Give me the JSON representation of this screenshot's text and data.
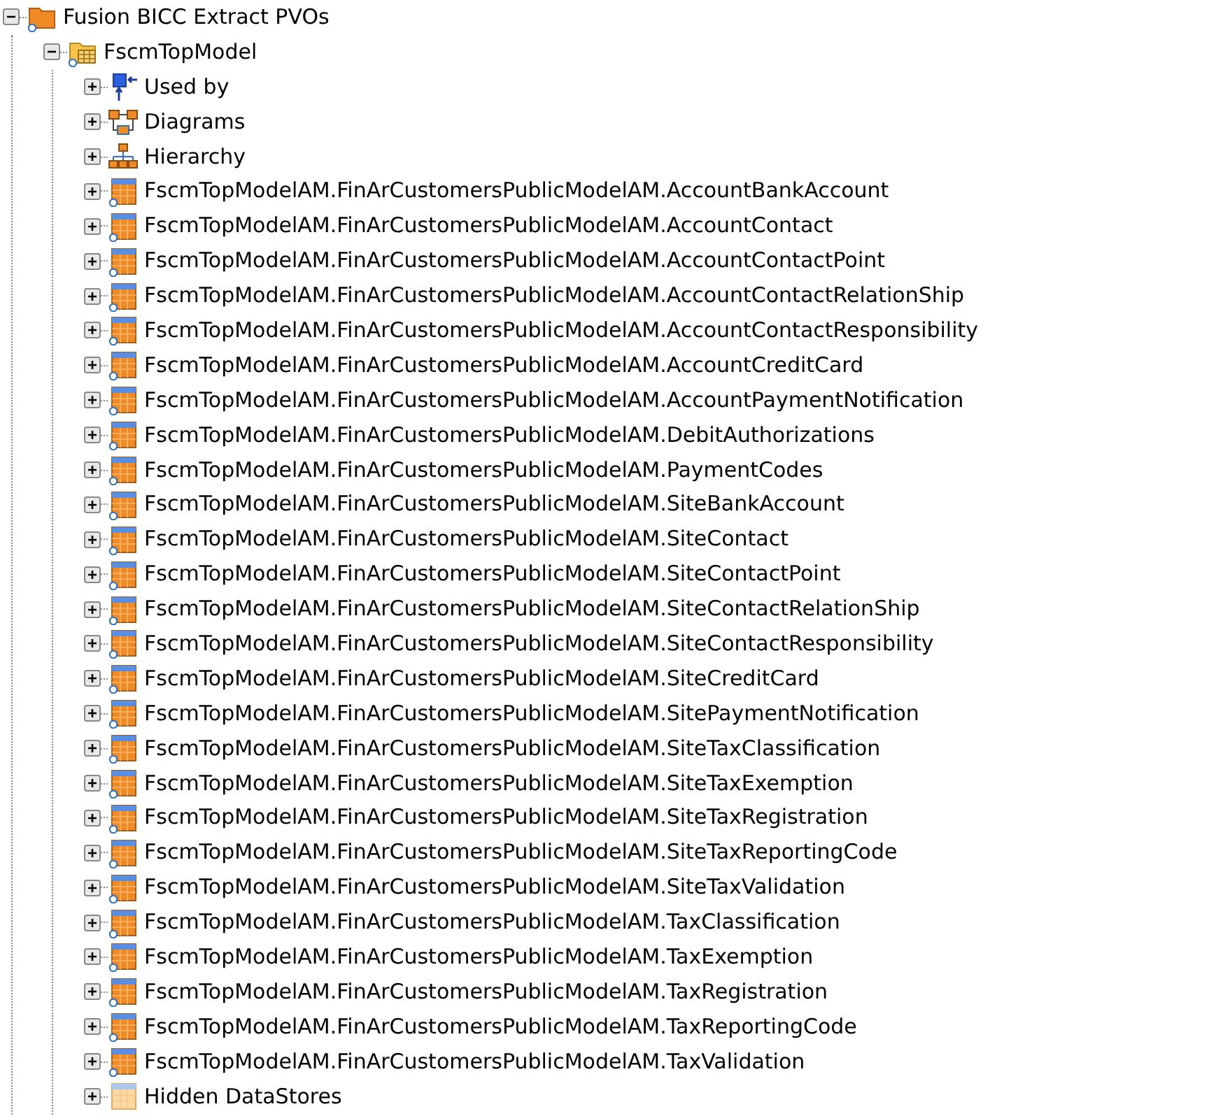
{
  "tree": [
    {
      "label": "Fusion BICC Extract PVOs",
      "kind": "folder",
      "expanded": true,
      "children": [
        {
          "label": "FscmTopModel",
          "kind": "model",
          "expanded": true,
          "children": [
            {
              "label": "Used by",
              "kind": "usedby",
              "expanded": false
            },
            {
              "label": "Diagrams",
              "kind": "diagrams",
              "expanded": false
            },
            {
              "label": "Hierarchy",
              "kind": "hierarchy",
              "expanded": false
            },
            {
              "label": "FscmTopModelAM.FinArCustomersPublicModelAM.AccountBankAccount",
              "kind": "datastore",
              "expanded": false
            },
            {
              "label": "FscmTopModelAM.FinArCustomersPublicModelAM.AccountContact",
              "kind": "datastore",
              "expanded": false
            },
            {
              "label": "FscmTopModelAM.FinArCustomersPublicModelAM.AccountContactPoint",
              "kind": "datastore",
              "expanded": false
            },
            {
              "label": "FscmTopModelAM.FinArCustomersPublicModelAM.AccountContactRelationShip",
              "kind": "datastore",
              "expanded": false
            },
            {
              "label": "FscmTopModelAM.FinArCustomersPublicModelAM.AccountContactResponsibility",
              "kind": "datastore",
              "expanded": false
            },
            {
              "label": "FscmTopModelAM.FinArCustomersPublicModelAM.AccountCreditCard",
              "kind": "datastore",
              "expanded": false
            },
            {
              "label": "FscmTopModelAM.FinArCustomersPublicModelAM.AccountPaymentNotification",
              "kind": "datastore",
              "expanded": false
            },
            {
              "label": "FscmTopModelAM.FinArCustomersPublicModelAM.DebitAuthorizations",
              "kind": "datastore",
              "expanded": false
            },
            {
              "label": "FscmTopModelAM.FinArCustomersPublicModelAM.PaymentCodes",
              "kind": "datastore",
              "expanded": false
            },
            {
              "label": "FscmTopModelAM.FinArCustomersPublicModelAM.SiteBankAccount",
              "kind": "datastore",
              "expanded": false
            },
            {
              "label": "FscmTopModelAM.FinArCustomersPublicModelAM.SiteContact",
              "kind": "datastore",
              "expanded": false
            },
            {
              "label": "FscmTopModelAM.FinArCustomersPublicModelAM.SiteContactPoint",
              "kind": "datastore",
              "expanded": false
            },
            {
              "label": "FscmTopModelAM.FinArCustomersPublicModelAM.SiteContactRelationShip",
              "kind": "datastore",
              "expanded": false
            },
            {
              "label": "FscmTopModelAM.FinArCustomersPublicModelAM.SiteContactResponsibility",
              "kind": "datastore",
              "expanded": false
            },
            {
              "label": "FscmTopModelAM.FinArCustomersPublicModelAM.SiteCreditCard",
              "kind": "datastore",
              "expanded": false
            },
            {
              "label": "FscmTopModelAM.FinArCustomersPublicModelAM.SitePaymentNotification",
              "kind": "datastore",
              "expanded": false
            },
            {
              "label": "FscmTopModelAM.FinArCustomersPublicModelAM.SiteTaxClassification",
              "kind": "datastore",
              "expanded": false
            },
            {
              "label": "FscmTopModelAM.FinArCustomersPublicModelAM.SiteTaxExemption",
              "kind": "datastore",
              "expanded": false
            },
            {
              "label": "FscmTopModelAM.FinArCustomersPublicModelAM.SiteTaxRegistration",
              "kind": "datastore",
              "expanded": false
            },
            {
              "label": "FscmTopModelAM.FinArCustomersPublicModelAM.SiteTaxReportingCode",
              "kind": "datastore",
              "expanded": false
            },
            {
              "label": "FscmTopModelAM.FinArCustomersPublicModelAM.SiteTaxValidation",
              "kind": "datastore",
              "expanded": false
            },
            {
              "label": "FscmTopModelAM.FinArCustomersPublicModelAM.TaxClassification",
              "kind": "datastore",
              "expanded": false
            },
            {
              "label": "FscmTopModelAM.FinArCustomersPublicModelAM.TaxExemption",
              "kind": "datastore",
              "expanded": false
            },
            {
              "label": "FscmTopModelAM.FinArCustomersPublicModelAM.TaxRegistration",
              "kind": "datastore",
              "expanded": false
            },
            {
              "label": "FscmTopModelAM.FinArCustomersPublicModelAM.TaxReportingCode",
              "kind": "datastore",
              "expanded": false
            },
            {
              "label": "FscmTopModelAM.FinArCustomersPublicModelAM.TaxValidation",
              "kind": "datastore",
              "expanded": false
            },
            {
              "label": "Hidden DataStores",
              "kind": "hidden",
              "expanded": false
            }
          ]
        }
      ]
    }
  ]
}
